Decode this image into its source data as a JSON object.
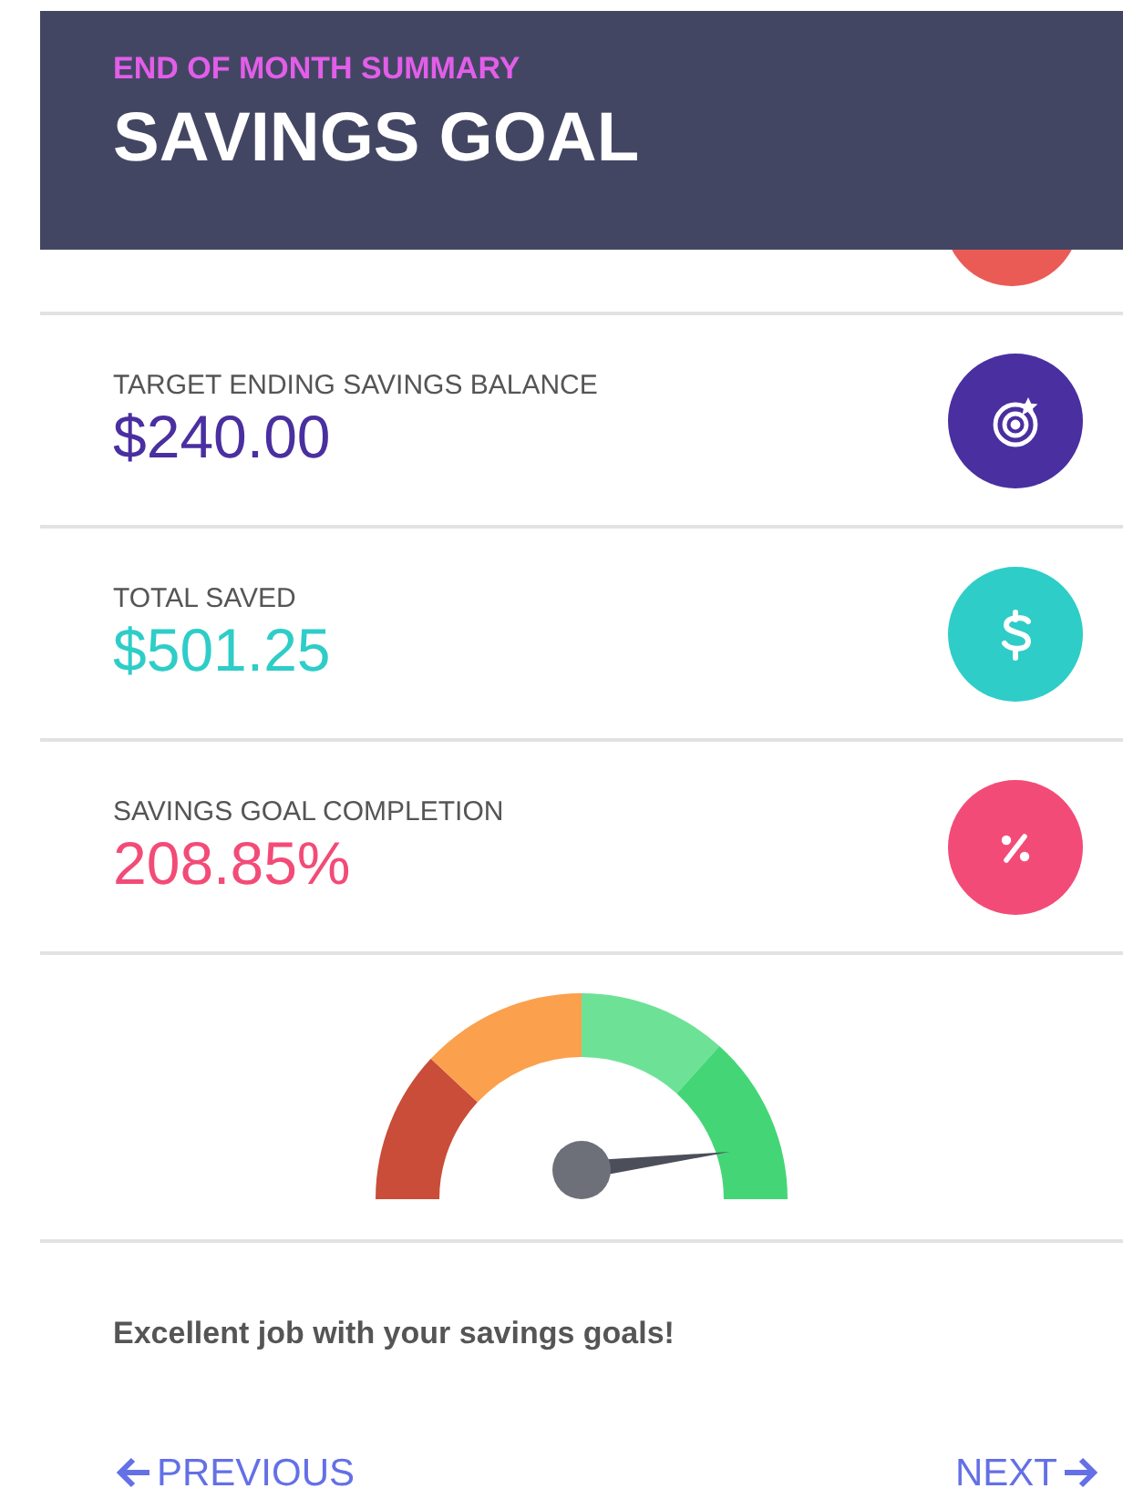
{
  "header": {
    "kicker": "END OF MONTH SUMMARY",
    "title": "SAVINGS GOAL"
  },
  "metrics": [
    {
      "kind": "partial",
      "color": "#eb5b56"
    },
    {
      "kind": "target",
      "label": "TARGET ENDING SAVINGS BALANCE",
      "value": "$240.00",
      "color": "#4a2fa0"
    },
    {
      "kind": "dollar",
      "label": "TOTAL SAVED",
      "value": "$501.25",
      "color": "#2ecdc8"
    },
    {
      "kind": "percent",
      "label": "SAVINGS GOAL COMPLETION",
      "value": "208.85%",
      "color": "#f34b77"
    }
  ],
  "message": "Excellent job with your savings goals!",
  "nav": {
    "previous": "PREVIOUS",
    "next": "NEXT"
  }
}
